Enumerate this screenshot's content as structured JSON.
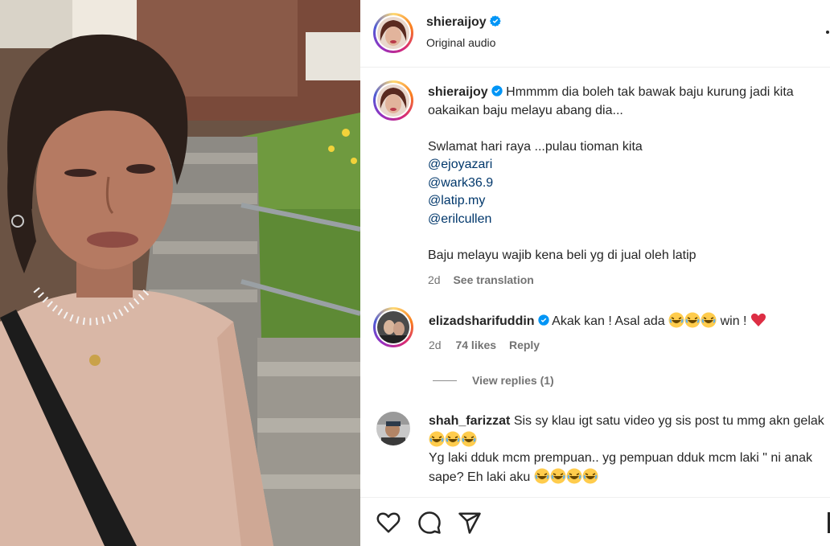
{
  "post": {
    "author": "shieraijoy",
    "audio": "Original audio",
    "caption_author": "shieraijoy",
    "caption_line1": "Hmmmm dia boleh tak bawak baju kurung jadi kita oakaikan baju melayu abang dia...",
    "caption_line2": "Swlamat hari raya ...pulau tioman kita",
    "mentions": [
      "@ejoyazari",
      "@wark36.9",
      "@latip.my",
      "@erilcullen"
    ],
    "caption_line3": "Baju melayu wajib kena beli yg di jual oleh latip",
    "time": "2d",
    "see_translation": "See translation"
  },
  "comments": [
    {
      "user": "elizadsharifuddin",
      "text_before": "Akak kan ! Asal ada",
      "text_after": "win !",
      "time": "2d",
      "likes": "74 likes",
      "reply": "Reply",
      "view_replies": "View replies (1)"
    },
    {
      "user": "shah_farizzat",
      "text_line1": "Sis sy klau igt satu video yg sis post tu mmg akn gelak",
      "text_line2": "Yg laki dduk mcm prempuan.. yg pempuan dduk mcm laki \" ni anak sape? Eh laki aku"
    }
  ],
  "icons": {
    "like": "heart-icon",
    "comment": "comment-icon",
    "share": "send-icon",
    "more": "more-icon",
    "verified": "verified-badge-icon"
  },
  "colors": {
    "verified": "#0095f6",
    "mention": "#00376b",
    "meta": "#737373",
    "heart": "#ed4956"
  }
}
